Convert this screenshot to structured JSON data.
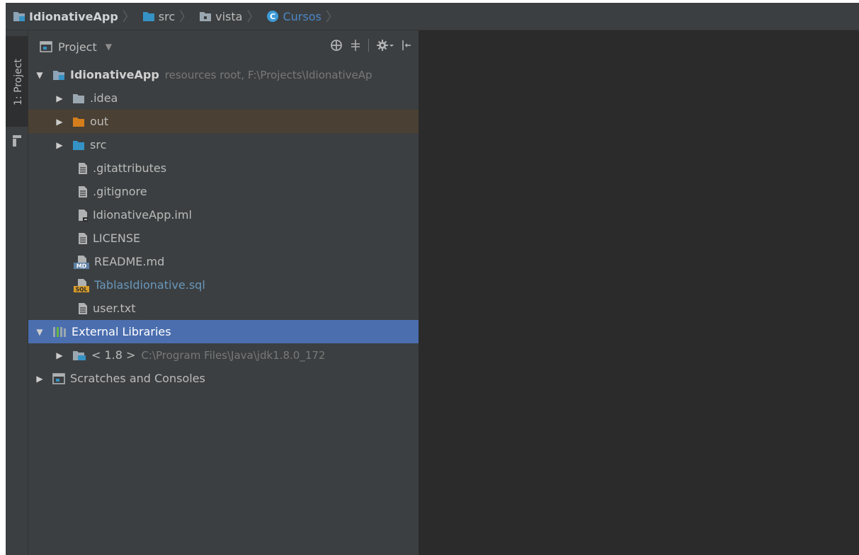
{
  "breadcrumb": {
    "project": "IdionativeApp",
    "items": [
      "src",
      "vista"
    ],
    "current": "Cursos",
    "class_badge": "C"
  },
  "toolstrip": {
    "project_tab_label": "1: Project"
  },
  "panel": {
    "title": "Project",
    "tools": [
      "locate-icon",
      "collapse-all-icon",
      "settings-icon",
      "hide-icon"
    ]
  },
  "tree": {
    "root": {
      "label": "IdionativeApp",
      "hint": "resources root,  F:\\Projects\\IdionativeAp"
    },
    "folders": [
      ".idea",
      "out",
      "src"
    ],
    "files": [
      ".gitattributes",
      ".gitignore",
      "IdionativeApp.iml",
      "LICENSE",
      "README.md",
      "TablasIdionative.sql",
      "user.txt"
    ],
    "md_badge": "MD",
    "sql_badge": "SQL",
    "external_libraries": "External Libraries",
    "jdk": {
      "label": "< 1.8 >",
      "path": "C:\\Program Files\\Java\\jdk1.8.0_172"
    },
    "scratches": "Scratches and Consoles"
  },
  "colors": {
    "folder_blue": "#3592c4",
    "folder_orange": "#d57e1b",
    "selection": "#4b6eaf",
    "highlight_row": "#4a4033",
    "sql_file_text": "#6897bb"
  }
}
